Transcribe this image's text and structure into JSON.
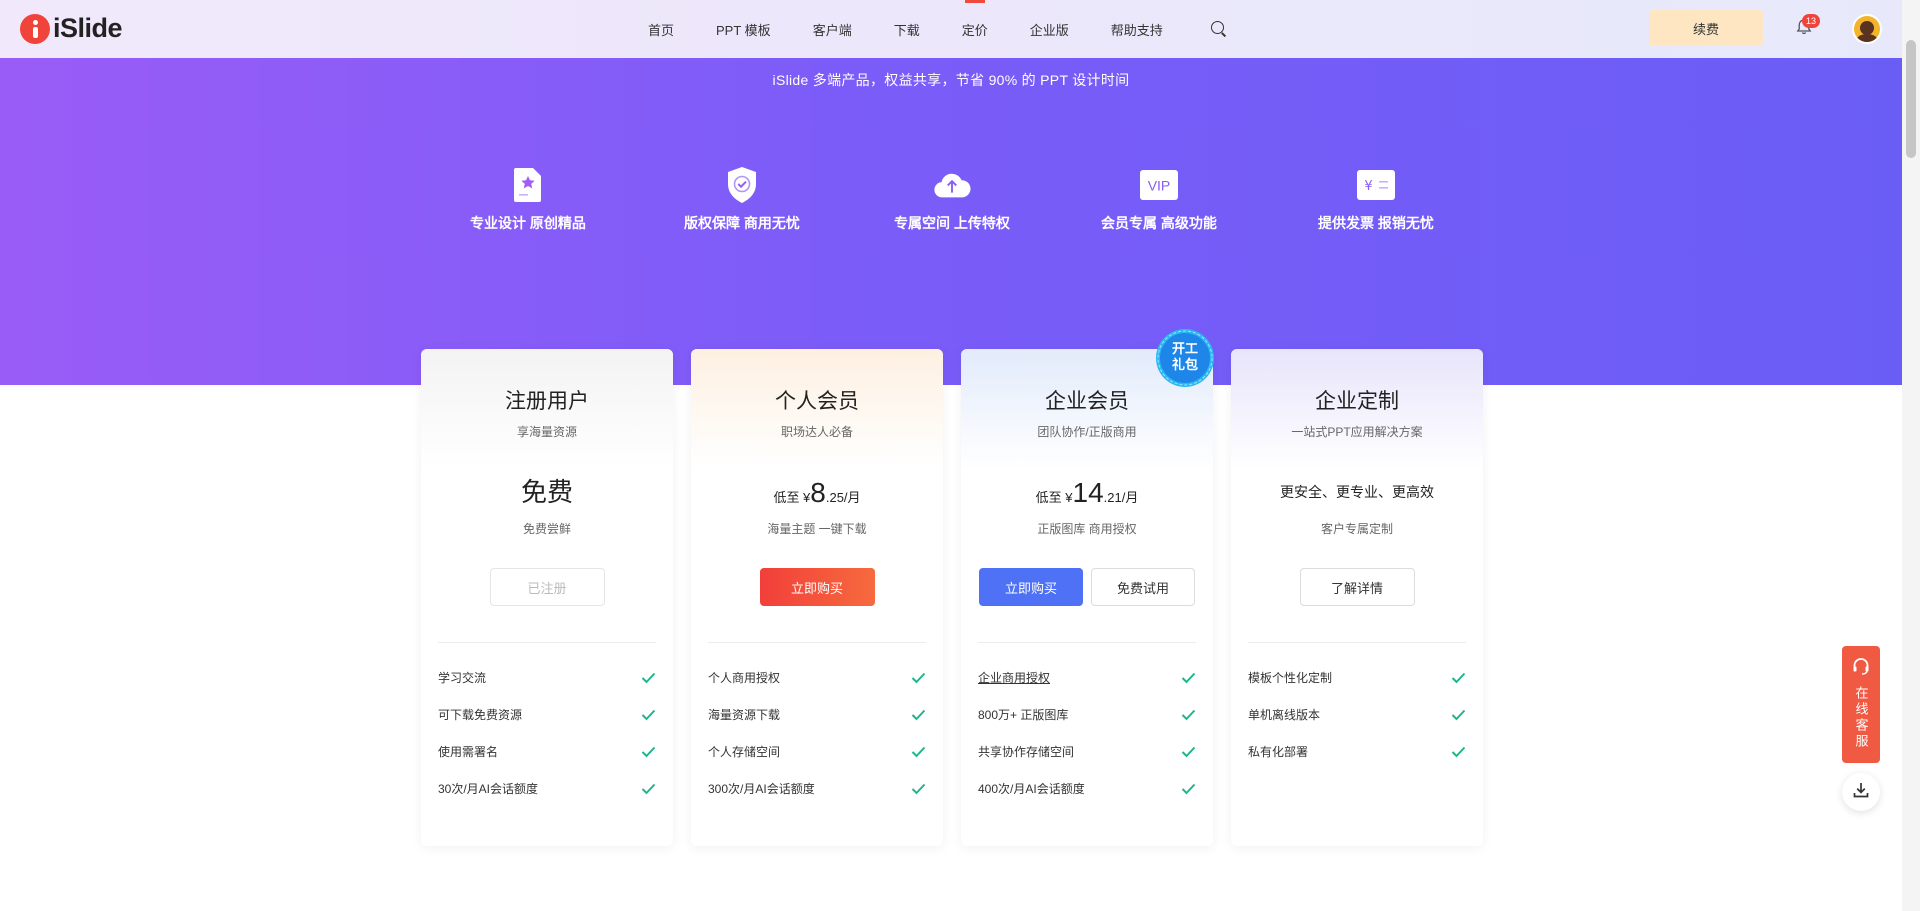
{
  "header": {
    "logo_text": "iSlide",
    "nav": [
      "首页",
      "PPT 模板",
      "客户端",
      "下载",
      "定价",
      "企业版",
      "帮助支持"
    ],
    "active_nav": "定价",
    "renew_label": "续费",
    "notification_count": "13"
  },
  "hero": {
    "tagline": "iSlide 多端产品，权益共享，节省 90% 的 PPT 设计时间",
    "benefits": [
      {
        "icon": "design-doc-icon",
        "label": "专业设计 原创精品"
      },
      {
        "icon": "shield-check-icon",
        "label": "版权保障 商用无忧"
      },
      {
        "icon": "cloud-upload-icon",
        "label": "专属空间 上传特权"
      },
      {
        "icon": "vip-icon",
        "label": "会员专属 高级功能"
      },
      {
        "icon": "invoice-icon",
        "label": "提供发票 报销无忧"
      }
    ]
  },
  "plans": [
    {
      "title": "注册用户",
      "subtitle": "享海量资源",
      "price_text": "免费",
      "desc": "免费尝鲜",
      "buttons": [
        "已注册"
      ],
      "features": [
        "学习交流",
        "可下载免费资源",
        "使用需署名",
        "30次/月AI会话额度"
      ]
    },
    {
      "title": "个人会员",
      "subtitle": "职场达人必备",
      "price_prefix": "低至 ¥",
      "price_big": "8",
      "price_suffix": ".25/月",
      "desc": "海量主题 一键下载",
      "buttons": [
        "立即购买"
      ],
      "features": [
        "个人商用授权",
        "海量资源下载",
        "个人存储空间",
        "300次/月AI会话额度"
      ]
    },
    {
      "title": "企业会员",
      "subtitle": "团队协作/正版商用",
      "price_prefix": "低至 ¥",
      "price_big": "14",
      "price_suffix": ".21/月",
      "desc": "正版图库 商用授权",
      "buttons": [
        "立即购买",
        "免费试用"
      ],
      "features": [
        "企业商用授权",
        "800万+ 正版图库",
        "共享协作存储空间",
        "400次/月AI会话额度"
      ],
      "badge": [
        "开工",
        "礼包"
      ]
    },
    {
      "title": "企业定制",
      "subtitle": "一站式PPT应用解决方案",
      "price_text": "更安全、更专业、更高效",
      "desc": "客户专属定制",
      "buttons": [
        "了解详情"
      ],
      "features": [
        "模板个性化定制",
        "单机离线版本",
        "私有化部署"
      ]
    }
  ],
  "float": {
    "service_label": "在线客服"
  },
  "colors": {
    "hero_start": "#9a5cf7",
    "hero_end": "#6a5df6",
    "buy_red": "#f23f3a",
    "buy_blue": "#4e71f5",
    "check_green": "#1db58c",
    "renew_bg": "#fde6c1"
  }
}
